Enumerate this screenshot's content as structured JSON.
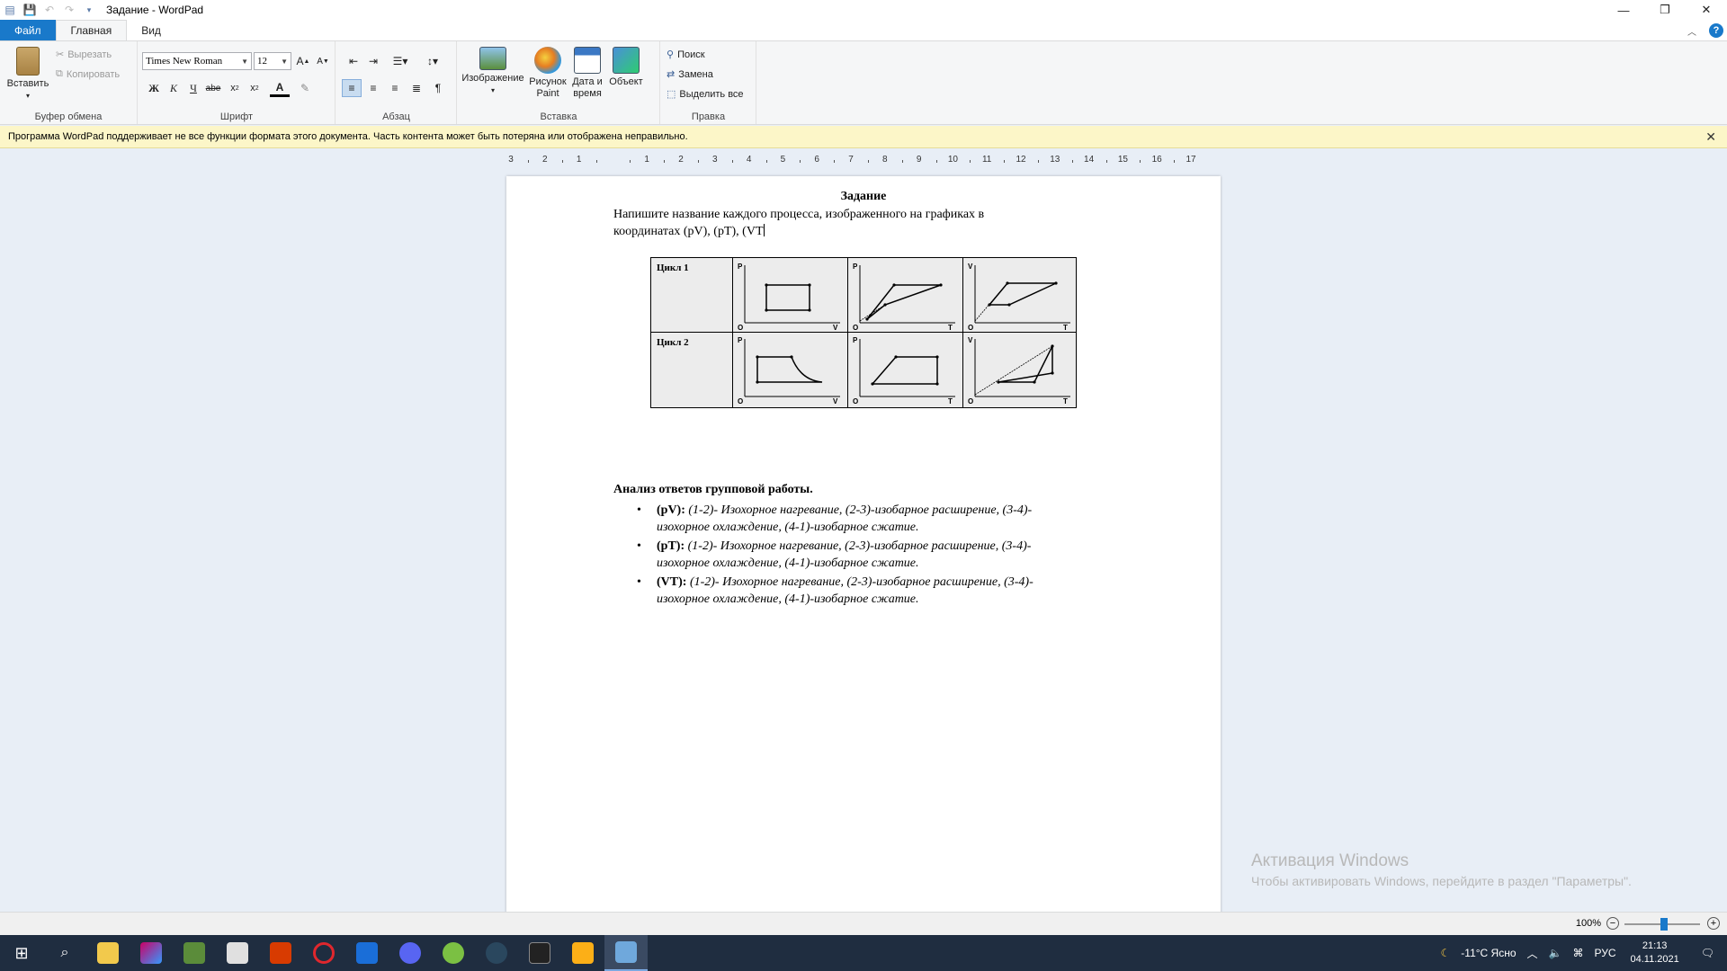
{
  "window": {
    "title": "Задание - WordPad"
  },
  "menu": {
    "file": "Файл",
    "home": "Главная",
    "view": "Вид"
  },
  "ribbon": {
    "clipboard": {
      "label": "Буфер обмена",
      "paste": "Вставить",
      "cut": "Вырезать",
      "copy": "Копировать"
    },
    "font": {
      "label": "Шрифт",
      "family": "Times New Roman",
      "size": "12",
      "bold": "Ж",
      "italic": "К",
      "underline": "Ч"
    },
    "paragraph": {
      "label": "Абзац"
    },
    "insert": {
      "label": "Вставка",
      "image": "Изображение",
      "paint": "Рисунок\nPaint",
      "paint_l1": "Рисунок",
      "paint_l2": "Paint",
      "datetime_l1": "Дата и",
      "datetime_l2": "время",
      "object": "Объект"
    },
    "edit": {
      "label": "Правка",
      "find": "Поиск",
      "replace": "Замена",
      "select_all": "Выделить все"
    }
  },
  "notice": {
    "text": "Программа WordPad поддерживает не все функции формата этого документа. Часть контента может быть потеряна или отображена неправильно."
  },
  "ruler": {
    "labels": [
      "3",
      "2",
      "1",
      "",
      "1",
      "2",
      "3",
      "4",
      "5",
      "6",
      "7",
      "8",
      "9",
      "10",
      "11",
      "12",
      "13",
      "14",
      "15",
      "16",
      "17"
    ]
  },
  "document": {
    "title": "Задание",
    "para_line1": "Напишите название каждого процесса, изображенного на графиках  в",
    "para_line2": "координатах  (pV),  (pT),  (VT",
    "table": {
      "rows": [
        {
          "label": "Цикл 1"
        },
        {
          "label": "Цикл 2"
        }
      ],
      "axes": [
        {
          "y": "P",
          "x": "V",
          "o": "O"
        },
        {
          "y": "P",
          "x": "T",
          "o": "O"
        },
        {
          "y": "V",
          "x": "T",
          "o": "O"
        }
      ]
    },
    "analysis_title": "Анализ ответов групповой работы.",
    "items": [
      {
        "key": "(pV):",
        "l1": "(1-2)- Изохорное нагревание, (2-3)-изобарное расширение, (3-4)-",
        "l2": "изохорное охлаждение, (4-1)-изобарное сжатие."
      },
      {
        "key": "(pT):",
        "l1": "(1-2)- Изохорное нагревание, (2-3)-изобарное расширение, (3-4)-",
        "l2": "изохорное охлаждение, (4-1)-изобарное сжатие."
      },
      {
        "key": "(VT):",
        "l1": "(1-2)- Изохорное нагревание, (2-3)-изобарное расширение, (3-4)-",
        "l2": "изохорное охлаждение, (4-1)-изобарное сжатие."
      }
    ]
  },
  "status": {
    "zoom": "100%"
  },
  "watermark": {
    "title": "Активация Windows",
    "text": "Чтобы активировать Windows, перейдите в раздел \"Параметры\"."
  },
  "tray": {
    "weather": "-11°C  Ясно",
    "lang": "РУС",
    "time": "21:13",
    "date": "04.11.2021"
  }
}
